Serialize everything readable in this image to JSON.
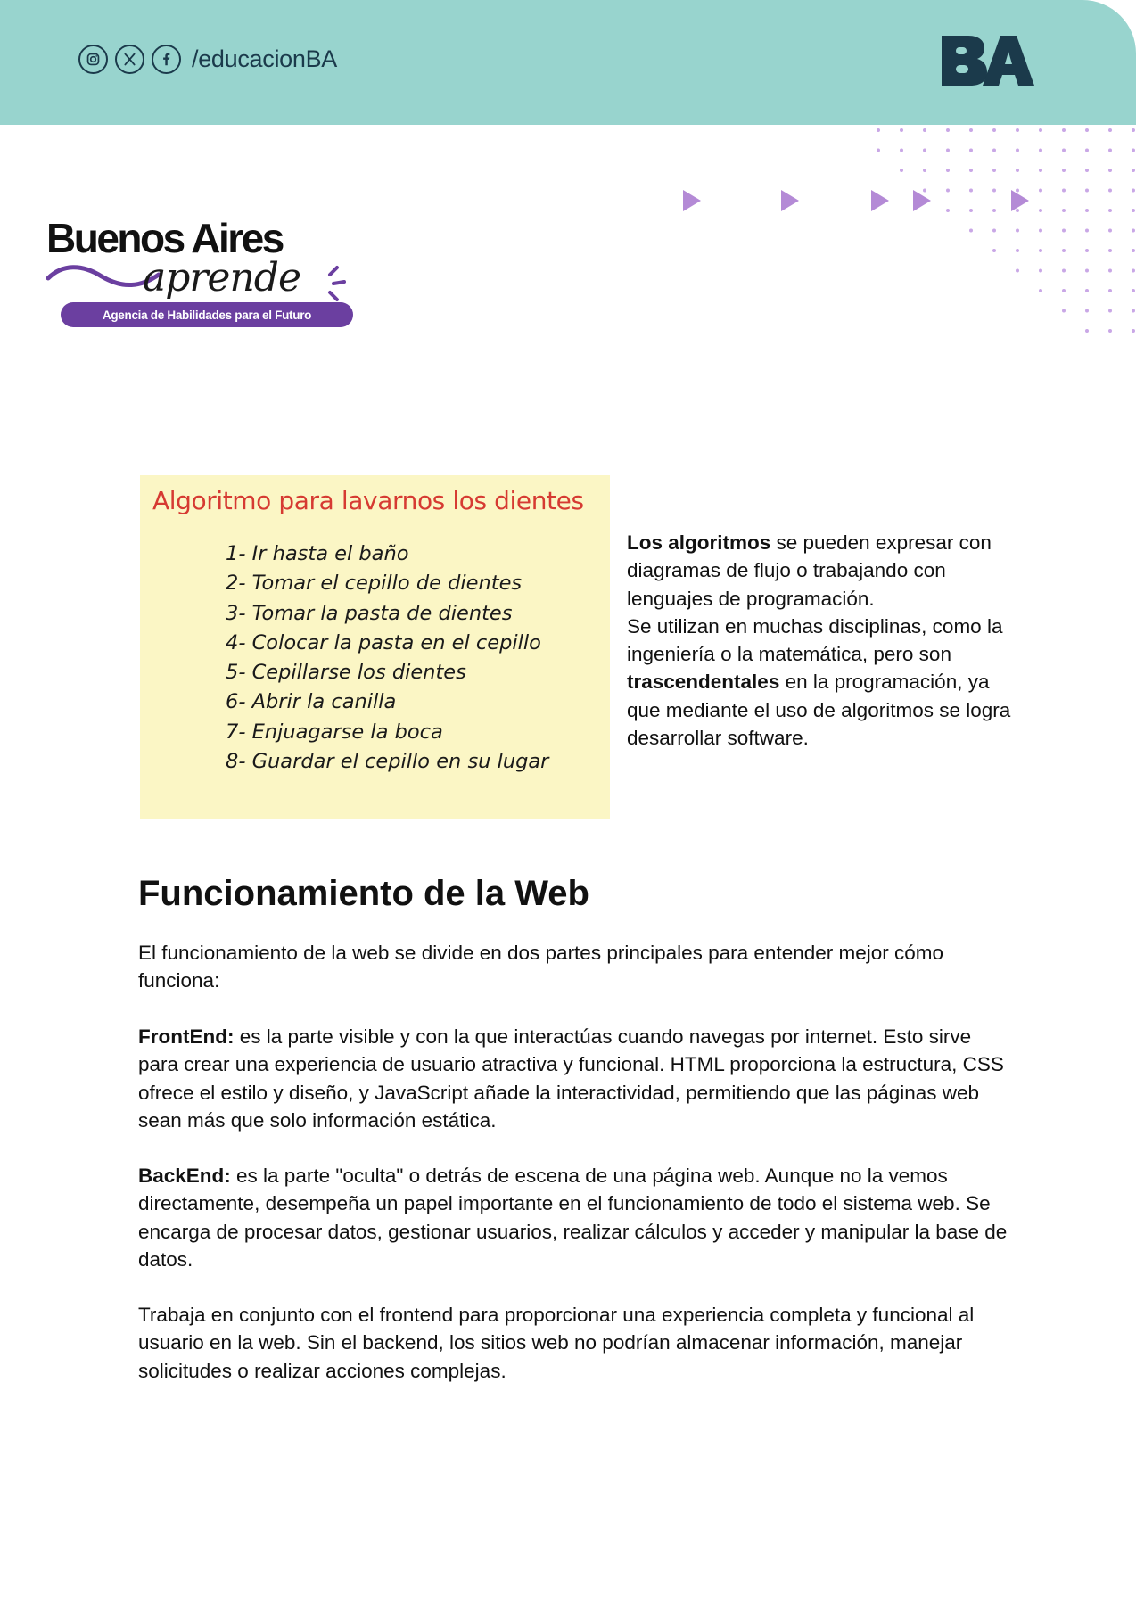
{
  "header": {
    "handle": "/educacionBA",
    "social_icons": [
      "instagram-icon",
      "x-icon",
      "facebook-icon"
    ],
    "logo_text": "BA",
    "bar_color": "#98d4ce"
  },
  "brand": {
    "title": "Buenos Aires",
    "script": "aprende",
    "tagline": "Agencia de Habilidades para el Futuro",
    "accent_color": "#6b3fa0"
  },
  "algorithm_card": {
    "title": "Algoritmo para lavarnos los dientes",
    "steps": [
      "1- Ir hasta el baño",
      "2- Tomar el cepillo de dientes",
      "3- Tomar la pasta de dientes",
      "4- Colocar la pasta en el cepillo",
      "5- Cepillarse los dientes",
      "6- Abrir la canilla",
      "7- Enjuagarse la boca",
      "8- Guardar el cepillo en su lugar"
    ]
  },
  "side": {
    "bold1": "Los algoritmos",
    "text1": " se pueden expresar con diagramas de flujo o trabajando con lenguajes de programación.",
    "text2": "Se utilizan en muchas disciplinas, como la ingeniería o la matemática, pero son ",
    "bold2": "trascendentales",
    "text3": " en la programación, ya que mediante el uso de algoritmos se logra desarrollar software."
  },
  "section": {
    "title": "Funcionamiento de la Web",
    "intro": "El funcionamiento de la web se divide en dos partes principales para entender mejor cómo funciona:",
    "frontend_label": "FrontEnd:",
    "frontend_text": " es la parte visible y con la que interactúas cuando navegas por internet. Esto sirve para crear una experiencia de usuario atractiva y funcional. HTML proporciona la estructura, CSS ofrece el estilo y diseño, y JavaScript añade la interactividad, permitiendo que las páginas web sean más que solo información estática.",
    "backend_label": "BackEnd:",
    "backend_text": " es la parte \"oculta\" o detrás de escena de una página web. Aunque no la vemos directamente, desempeña un papel importante en el funcionamiento de todo el sistema web. Se encarga de procesar datos, gestionar usuarios, realizar cálculos y acceder y manipular la base de datos.",
    "closing": "Trabaja en conjunto con el frontend para proporcionar una experiencia completa y funcional al usuario en la web. Sin el backend, los sitios web no podrían almacenar información, manejar solicitudes o realizar acciones complejas."
  }
}
